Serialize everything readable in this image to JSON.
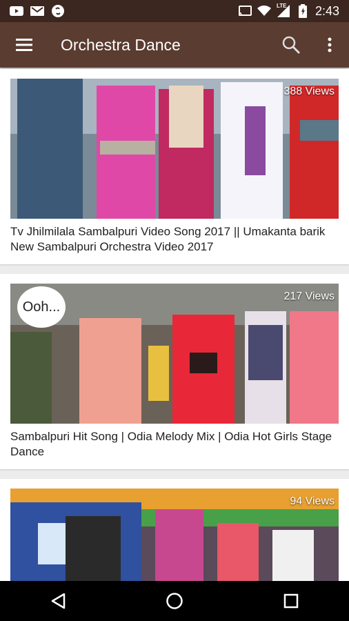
{
  "status_bar": {
    "icons": [
      "youtube-icon",
      "gmail-icon",
      "shazam-icon",
      "cast-icon",
      "wifi-icon",
      "lte-signal-icon",
      "battery-icon"
    ],
    "network": "LTE",
    "time": "2:43"
  },
  "app_bar": {
    "title": "Orchestra Dance",
    "icons": [
      "menu-icon",
      "search-icon",
      "more-vert-icon"
    ]
  },
  "videos": [
    {
      "views": "388 Views",
      "title": "Tv Jhilmilala Sambalpuri Video Song 2017 || Umakanta barik New Sambalpuri Orchestra Video 2017"
    },
    {
      "views": "217 Views",
      "title": "Sambalpuri Hit Song | Odia Melody Mix | Odia Hot Girls Stage Dance",
      "overlay_text": "Ooh..."
    },
    {
      "views": "94 Views",
      "title": ""
    }
  ],
  "nav_bar": {
    "icons": [
      "back-icon",
      "home-icon",
      "recents-icon"
    ]
  },
  "colors": {
    "status_bar": "#3b2620",
    "app_bar": "#5a3c30",
    "background": "#ececec"
  }
}
